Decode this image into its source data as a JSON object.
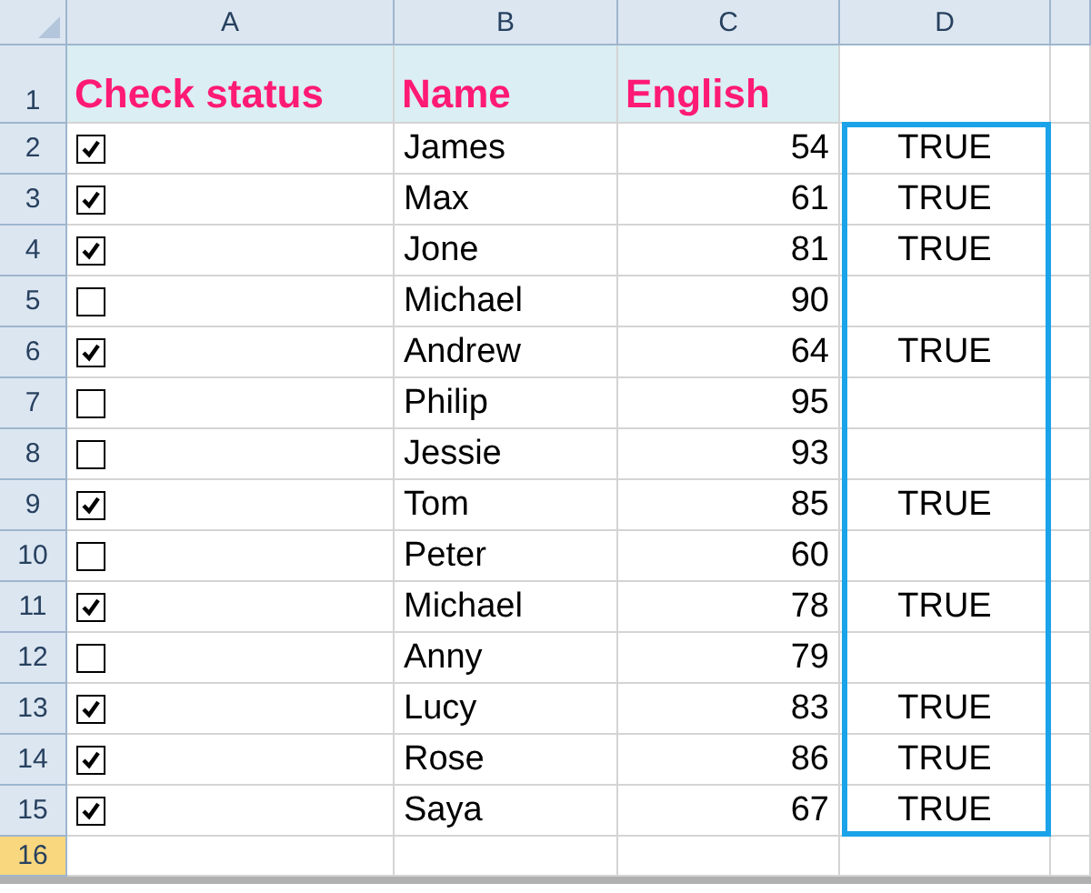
{
  "columns": [
    {
      "label": "A",
      "outlined": false
    },
    {
      "label": "B",
      "outlined": false
    },
    {
      "label": "C",
      "outlined": false
    },
    {
      "label": "D",
      "outlined": true
    }
  ],
  "rows": [
    {
      "header": "1",
      "kind": "title",
      "selected": false,
      "cells": [
        "Check status",
        "Name",
        "English"
      ]
    },
    {
      "header": "2",
      "kind": "data",
      "selected": false,
      "checked": true,
      "name": "James",
      "english": "54",
      "result": "TRUE"
    },
    {
      "header": "3",
      "kind": "data",
      "selected": false,
      "checked": true,
      "name": "Max",
      "english": "61",
      "result": "TRUE"
    },
    {
      "header": "4",
      "kind": "data",
      "selected": false,
      "checked": true,
      "name": "Jone",
      "english": "81",
      "result": "TRUE"
    },
    {
      "header": "5",
      "kind": "data",
      "selected": false,
      "checked": false,
      "name": "Michael",
      "english": "90"
    },
    {
      "header": "6",
      "kind": "data",
      "selected": false,
      "checked": true,
      "name": "Andrew",
      "english": "64",
      "result": "TRUE"
    },
    {
      "header": "7",
      "kind": "data",
      "selected": false,
      "checked": false,
      "name": "Philip",
      "english": "95"
    },
    {
      "header": "8",
      "kind": "data",
      "selected": false,
      "checked": false,
      "name": "Jessie",
      "english": "93"
    },
    {
      "header": "9",
      "kind": "data",
      "selected": false,
      "checked": true,
      "name": "Tom",
      "english": "85",
      "result": "TRUE"
    },
    {
      "header": "10",
      "kind": "data",
      "selected": false,
      "checked": false,
      "name": "Peter",
      "english": "60"
    },
    {
      "header": "11",
      "kind": "data",
      "selected": false,
      "checked": true,
      "name": "Michael",
      "english": "78",
      "result": "TRUE"
    },
    {
      "header": "12",
      "kind": "data",
      "selected": false,
      "checked": false,
      "name": "Anny",
      "english": "79"
    },
    {
      "header": "13",
      "kind": "data",
      "selected": false,
      "checked": true,
      "name": "Lucy",
      "english": "83",
      "result": "TRUE"
    },
    {
      "header": "14",
      "kind": "data",
      "selected": false,
      "checked": true,
      "name": "Rose",
      "english": "86",
      "result": "TRUE"
    },
    {
      "header": "15",
      "kind": "data",
      "selected": false,
      "checked": true,
      "name": "Saya",
      "english": "67",
      "result": "TRUE"
    },
    {
      "header": "16",
      "kind": "empty",
      "selected": true
    }
  ]
}
